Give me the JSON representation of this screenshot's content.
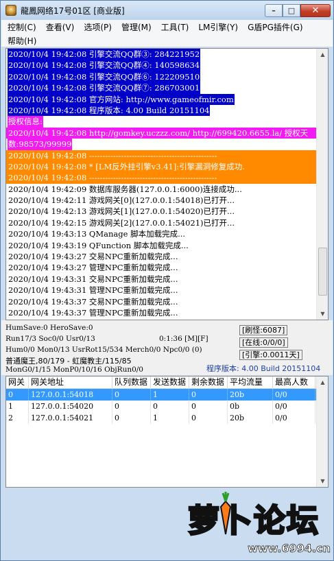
{
  "window": {
    "title": "龍鳳网络17号01区 [商业版]",
    "controls": {
      "minimize": "–",
      "maximize": "□",
      "close": "✕"
    }
  },
  "menu": {
    "items": [
      "控制(C)",
      "查看(V)",
      "选项(P)",
      "管理(M)",
      "工具(T)",
      "LM引擎(Y)",
      "G盾PG插件(G)",
      "帮助(H)"
    ]
  },
  "log": {
    "lines": [
      {
        "text": "2020/10/4 19:42:08 引擎交流QQ群③: 284221952",
        "style": "blue"
      },
      {
        "text": "2020/10/4 19:42:08 引擎交流QQ群④: 140598634",
        "style": "blue"
      },
      {
        "text": "2020/10/4 19:42:08 引擎交流QQ群⑥: 122209510",
        "style": "blue"
      },
      {
        "text": "2020/10/4 19:42:08 引擎交流QQ群⑦: 286703001",
        "style": "blue"
      },
      {
        "text": "2020/10/4 19:42:08 官方网站: http://www.gameofmir.com",
        "style": "blue"
      },
      {
        "text": "2020/10/4 19:42:08 程序版本: 4.00 Build 20151104",
        "style": "blue"
      },
      {
        "text": "授权信息:",
        "style": "magenta"
      },
      {
        "text": "2020/10/4 19:42:08 http://gomkey.uczzz.com/ http://699420.6655.la/ 授权天",
        "style": "magenta-full"
      },
      {
        "text": "数:98573/99999",
        "style": "magenta"
      },
      {
        "text": "2020/10/4 19:42:08 ------------------------------------------------",
        "style": "orange"
      },
      {
        "text": "2020/10/4 19:42:08 * [LM反外挂引擎v3.41]:引擎漏洞修复成功.",
        "style": "orange"
      },
      {
        "text": "2020/10/4 19:42:08 ------------------------------------------------",
        "style": "orange"
      },
      {
        "text": "2020/10/4 19:42:09 数据库服务器(127.0.0.1:6000)连接成功...",
        "style": "plain"
      },
      {
        "text": "2020/10/4 19:42:11 游戏网关[0](127.0.0.1:54018)已打开...",
        "style": "plain"
      },
      {
        "text": "2020/10/4 19:42:13 游戏网关[1](127.0.0.1:54020)已打开...",
        "style": "plain"
      },
      {
        "text": "2020/10/4 19:42:15 游戏网关[2](127.0.0.1:54021)已打开...",
        "style": "plain"
      },
      {
        "text": "2020/10/4 19:43:13 QManage 脚本加载完成...",
        "style": "plain"
      },
      {
        "text": "2020/10/4 19:43:19 QFunction 脚本加载完成...",
        "style": "plain"
      },
      {
        "text": "2020/10/4 19:43:27 交易NPC重新加载完成...",
        "style": "plain"
      },
      {
        "text": "2020/10/4 19:43:27 管理NPC重新加载完成...",
        "style": "plain"
      },
      {
        "text": "2020/10/4 19:43:31 交易NPC重新加载完成...",
        "style": "plain"
      },
      {
        "text": "2020/10/4 19:43:31 管理NPC重新加载完成...",
        "style": "plain"
      },
      {
        "text": "2020/10/4 19:43:37 交易NPC重新加载完成...",
        "style": "plain"
      },
      {
        "text": "2020/10/4 19:43:37 管理NPC重新加载完成...",
        "style": "plain"
      }
    ]
  },
  "status": {
    "humsave": "HumSave:0 HeroSave:0",
    "run": "Run17/3 Soc0/0 Usr0/13",
    "time": "0:1:36 [M][F]",
    "hum": "Hum0/0 Mon0/13 UsrRot15/534 Merch0/0 Npc0/0 (0)",
    "boss": "普通魔王,80/179 - 虹魔教主/115/85",
    "mon": "MonG0/1/15 MonP0/10/16 ObjRun0/0",
    "refresh_monster": "[刷怪:6087]",
    "online": "[在线:0/0/0]",
    "engine": "[引擎:0.0011天]",
    "version": "程序版本: 4.00 Build 20151104"
  },
  "gateway_table": {
    "headers": [
      "网关",
      "网关地址",
      "队列数据",
      "发送数据",
      "剩余数据",
      "平均流量",
      "最高人数"
    ],
    "rows": [
      [
        "0",
        "127.0.0.1:54018",
        "0",
        "1",
        "0",
        "20b",
        "0/0"
      ],
      [
        "1",
        "127.0.0.1:54020",
        "0",
        "0",
        "0",
        "0b",
        "0/0"
      ],
      [
        "2",
        "127.0.0.1:54021",
        "0",
        "1",
        "0",
        "20b",
        "0/0"
      ]
    ],
    "selected_row": 0
  },
  "watermark": {
    "text": "萝卜论坛",
    "url": "www.6994.cn"
  },
  "colors": {
    "log_blue": "#0000c8",
    "log_magenta": "#f21cf2",
    "log_orange": "#ff8a00",
    "selection": "#3399ff",
    "version_text": "#1d3da8"
  }
}
